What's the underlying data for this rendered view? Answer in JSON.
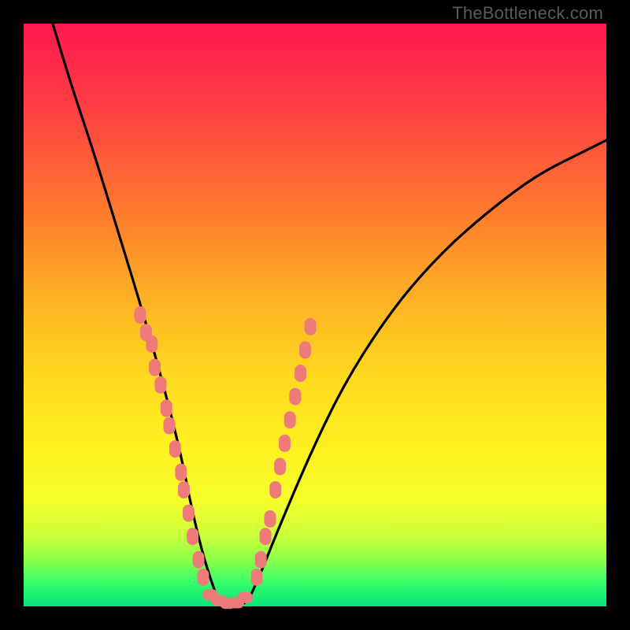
{
  "attribution": "TheBottleneck.com",
  "chart_data": {
    "type": "line",
    "title": "",
    "xlabel": "",
    "ylabel": "",
    "xlim": [
      0,
      100
    ],
    "ylim": [
      0,
      100
    ],
    "curve": {
      "note": "V-shaped bottleneck curve; values estimated from pixels (y = height above bottom)",
      "x": [
        5,
        8,
        12,
        16,
        20,
        24,
        27,
        29,
        31,
        33,
        34,
        38,
        40,
        44,
        50,
        56,
        64,
        72,
        80,
        88,
        96,
        100
      ],
      "y": [
        100,
        90,
        78,
        65,
        52,
        38,
        26,
        16,
        8,
        2,
        0,
        0,
        4,
        14,
        28,
        40,
        52,
        61,
        68,
        74,
        78,
        80
      ]
    },
    "markers_left": {
      "note": "salmon dots on left branch; (x,y) estimated",
      "points": [
        [
          20,
          50
        ],
        [
          21,
          47
        ],
        [
          22,
          45
        ],
        [
          22.5,
          41
        ],
        [
          23.5,
          38
        ],
        [
          24.5,
          34
        ],
        [
          25,
          31
        ],
        [
          26,
          27
        ],
        [
          27,
          23
        ],
        [
          27.5,
          20
        ],
        [
          28.3,
          16
        ],
        [
          29,
          12
        ],
        [
          30,
          8
        ],
        [
          30.8,
          5
        ]
      ]
    },
    "markers_right": {
      "note": "salmon dots on right branch; (x,y) estimated",
      "points": [
        [
          40,
          5
        ],
        [
          40.7,
          8
        ],
        [
          41.5,
          12
        ],
        [
          42.3,
          15
        ],
        [
          43.2,
          20
        ],
        [
          44,
          24
        ],
        [
          44.8,
          28
        ],
        [
          45.7,
          32
        ],
        [
          46.6,
          36
        ],
        [
          47.5,
          40
        ],
        [
          48.3,
          44
        ],
        [
          49.2,
          48
        ]
      ]
    },
    "markers_bottom": {
      "note": "salmon dots along the valley floor",
      "points": [
        [
          32,
          2
        ],
        [
          33.5,
          1
        ],
        [
          35,
          0.5
        ],
        [
          36.5,
          0.6
        ],
        [
          38,
          1.5
        ]
      ]
    },
    "background_gradient": {
      "stops": [
        {
          "pos": 0.0,
          "color": "#ff1a4d"
        },
        {
          "pos": 0.32,
          "color": "#ff7a2e"
        },
        {
          "pos": 0.6,
          "color": "#ffd81f"
        },
        {
          "pos": 0.82,
          "color": "#f4ff2a"
        },
        {
          "pos": 1.0,
          "color": "#09e27b"
        }
      ]
    }
  }
}
